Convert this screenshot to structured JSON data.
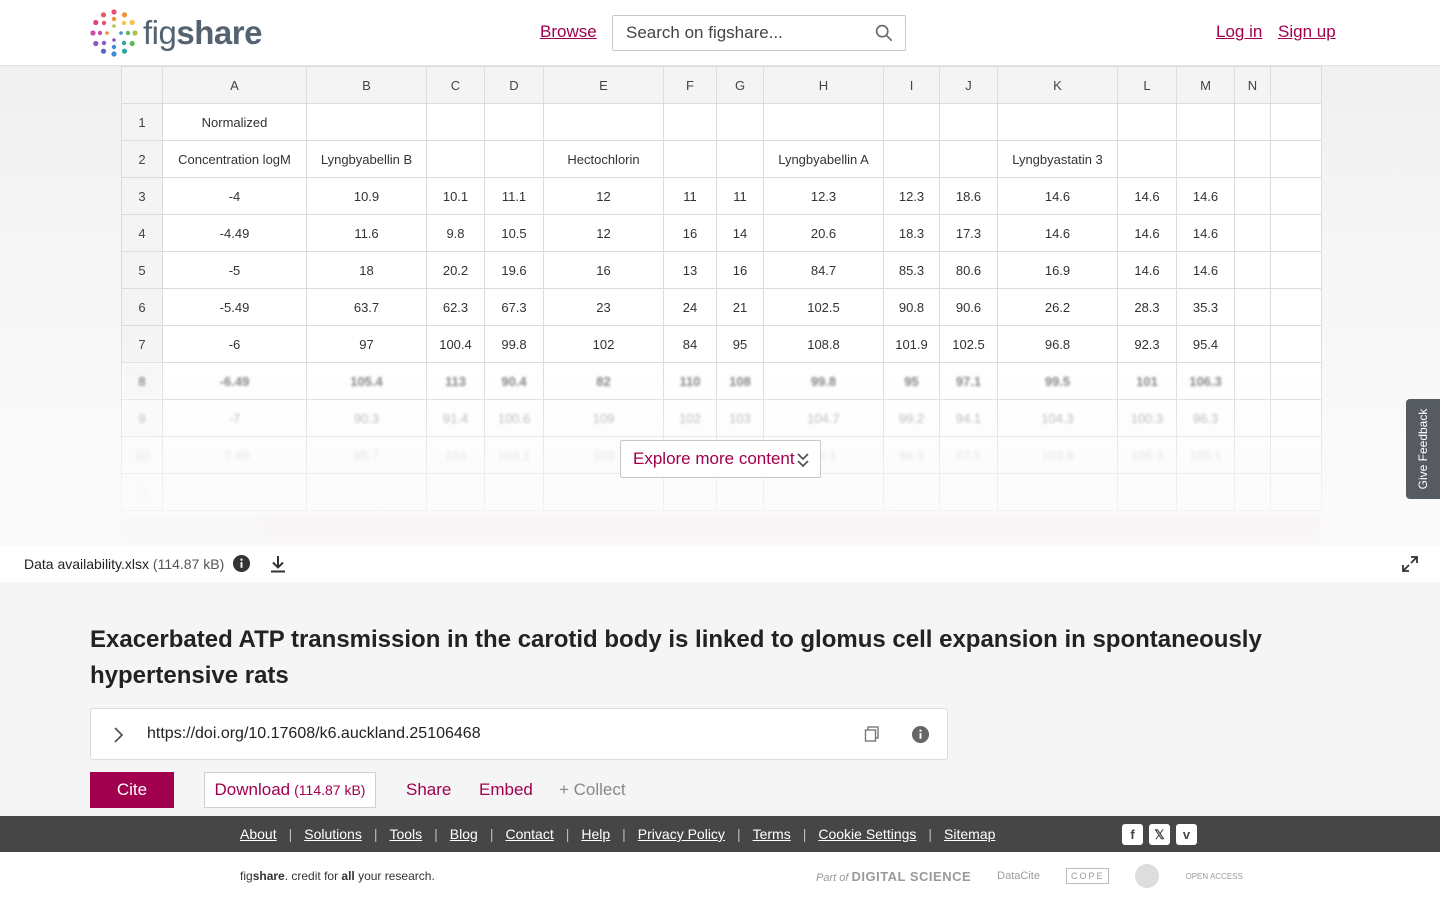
{
  "header": {
    "logo_text_light": "fig",
    "logo_text_bold": "share",
    "browse": "Browse",
    "search_placeholder": "Search on figshare...",
    "login": "Log in",
    "signup": "Sign up"
  },
  "sheet": {
    "columns": [
      "A",
      "B",
      "C",
      "D",
      "E",
      "F",
      "G",
      "H",
      "I",
      "J",
      "K",
      "L",
      "M",
      "N",
      ""
    ],
    "rows": [
      [
        "1",
        "Normalized",
        "",
        "",
        "",
        "",
        "",
        "",
        "",
        "",
        "",
        "",
        "",
        "",
        "",
        ""
      ],
      [
        "2",
        "Concentration logM",
        "Lyngbyabellin B",
        "",
        "",
        "Hectochlorin",
        "",
        "",
        "Lyngbyabellin A",
        "",
        "",
        "Lyngbyastatin 3",
        "",
        "",
        "",
        ""
      ],
      [
        "3",
        "-4",
        "10.9",
        "10.1",
        "11.1",
        "12",
        "11",
        "11",
        "12.3",
        "12.3",
        "18.6",
        "14.6",
        "14.6",
        "14.6",
        "",
        ""
      ],
      [
        "4",
        "-4.49",
        "11.6",
        "9.8",
        "10.5",
        "12",
        "16",
        "14",
        "20.6",
        "18.3",
        "17.3",
        "14.6",
        "14.6",
        "14.6",
        "",
        ""
      ],
      [
        "5",
        "-5",
        "18",
        "20.2",
        "19.6",
        "16",
        "13",
        "16",
        "84.7",
        "85.3",
        "80.6",
        "16.9",
        "14.6",
        "14.6",
        "",
        ""
      ],
      [
        "6",
        "-5.49",
        "63.7",
        "62.3",
        "67.3",
        "23",
        "24",
        "21",
        "102.5",
        "90.8",
        "90.6",
        "26.2",
        "28.3",
        "35.3",
        "",
        ""
      ],
      [
        "7",
        "-6",
        "97",
        "100.4",
        "99.8",
        "102",
        "84",
        "95",
        "108.8",
        "101.9",
        "102.5",
        "96.8",
        "92.3",
        "95.4",
        "",
        ""
      ],
      [
        "8",
        "-6.49",
        "105.4",
        "113",
        "90.4",
        "82",
        "110",
        "108",
        "99.8",
        "95",
        "97.1",
        "99.5",
        "101",
        "106.3",
        "",
        ""
      ],
      [
        "9",
        "-7",
        "90.3",
        "91.4",
        "100.6",
        "109",
        "102",
        "103",
        "104.7",
        "99.2",
        "94.1",
        "104.3",
        "100.3",
        "96.3",
        "",
        ""
      ],
      [
        "10",
        "-7.49",
        "95.7",
        "104",
        "104.1",
        "103",
        "",
        "",
        "90.1",
        "94.9",
        "87.5",
        "103.8",
        "106.3",
        "105.1",
        "",
        ""
      ],
      [
        "11",
        "",
        "",
        "",
        "",
        "",
        "",
        "",
        "",
        "",
        "",
        "",
        "",
        "",
        "",
        ""
      ]
    ],
    "explore_label": "Explore more content"
  },
  "feedback": "Give Feedback",
  "file": {
    "name": "Data availability.xlsx",
    "size": "(114.87 kB)"
  },
  "article": {
    "title": "Exacerbated ATP transmission in the carotid body is linked to glomus cell expansion in spontaneously hypertensive rats",
    "doi_url": "https://doi.org/10.17608/k6.auckland.25106468",
    "cite": "Cite",
    "download": "Download",
    "download_size": "(114.87 kB)",
    "share": "Share",
    "embed": "Embed",
    "collect": "+ Collect"
  },
  "footer": {
    "links": [
      "About",
      "Solutions",
      "Tools",
      "Blog",
      "Contact",
      "Help",
      "Privacy Policy",
      "Terms",
      "Cookie Settings",
      "Sitemap"
    ],
    "tagline_fig": "fig",
    "tagline_share": "share",
    "tagline_mid": ". credit for ",
    "tagline_all": "all",
    "tagline_end": " your research.",
    "partner_part_of": "Part of",
    "partner_ds": "DIGITAL SCIENCE",
    "partner_datacite": "DataCite",
    "partner_cope": "COPE",
    "partner_oa": "OPEN ACCESS"
  },
  "colors": {
    "brand": "#a0004d",
    "footer_bg": "#464646"
  }
}
